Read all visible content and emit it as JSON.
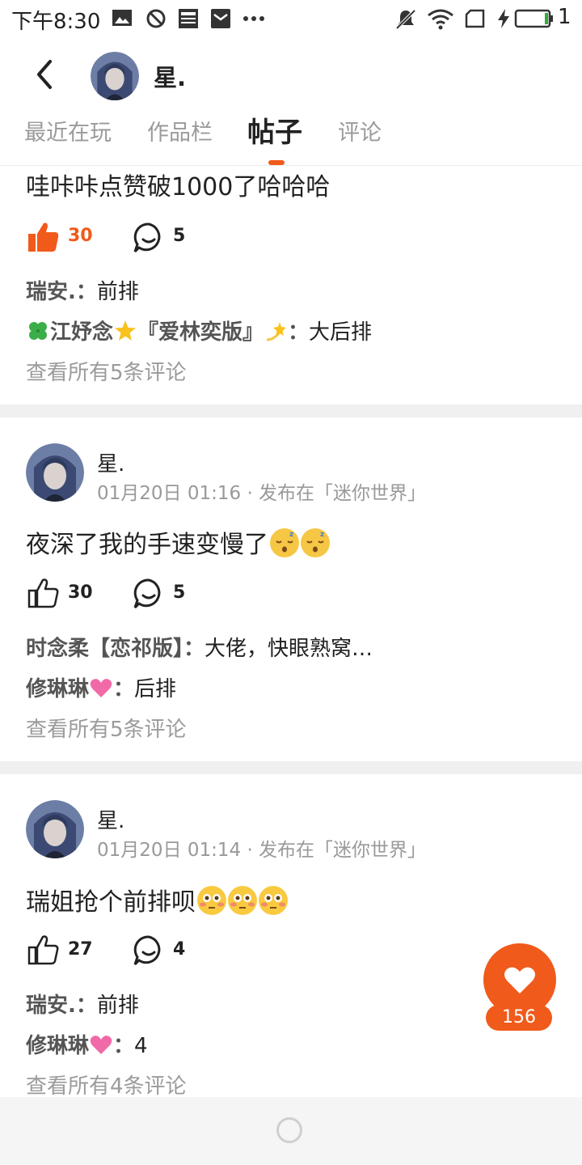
{
  "status_bar": {
    "time": "下午8:30",
    "battery_level": "1",
    "icons": [
      "image-icon",
      "block-icon",
      "news-icon",
      "mail-icon",
      "more-icon",
      "mute-icon",
      "wifi-icon",
      "sim-icon",
      "charging-icon",
      "battery-icon"
    ]
  },
  "header": {
    "username": "星."
  },
  "tabs": [
    {
      "label": "最近在玩",
      "active": false
    },
    {
      "label": "作品栏",
      "active": false
    },
    {
      "label": "帖子",
      "active": true
    },
    {
      "label": "评论",
      "active": false
    }
  ],
  "posts": [
    {
      "text": "哇咔咔点赞破1000了哈哈哈",
      "likes": "30",
      "liked": true,
      "comments_count": "5",
      "comments": [
        {
          "author": "瑞安.",
          "sep": "：",
          "text": "前排"
        },
        {
          "author_parts": [
            "江妤念",
            "『爱林奕版』"
          ],
          "sep": "：",
          "text": "大后排"
        }
      ],
      "view_all": "查看所有5条评论"
    },
    {
      "username": "星.",
      "meta": "01月20日 01:16 · 发布在「迷你世界」",
      "text": "夜深了我的手速变慢了",
      "likes": "30",
      "liked": false,
      "comments_count": "5",
      "comments": [
        {
          "author": "时念柔【恋祁版】",
          "sep": "：",
          "text": "大佬，快眼熟窝…"
        },
        {
          "author": "修琳琳",
          "sep": "：",
          "text": "后排"
        }
      ],
      "view_all": "查看所有5条评论"
    },
    {
      "username": "星.",
      "meta": "01月20日 01:14 · 发布在「迷你世界」",
      "text": "瑞姐抢个前排呗",
      "likes": "27",
      "liked": false,
      "comments_count": "4",
      "comments": [
        {
          "author": "瑞安.",
          "sep": "：",
          "text": "前排"
        },
        {
          "author": "修琳琳",
          "sep": "：",
          "text": "4"
        }
      ],
      "view_all": "查看所有4条评论"
    }
  ],
  "fab": {
    "count": "156"
  },
  "colors": {
    "accent": "#f05a1a",
    "divider": "#f0f0f0",
    "muted": "#9b9b9b"
  }
}
